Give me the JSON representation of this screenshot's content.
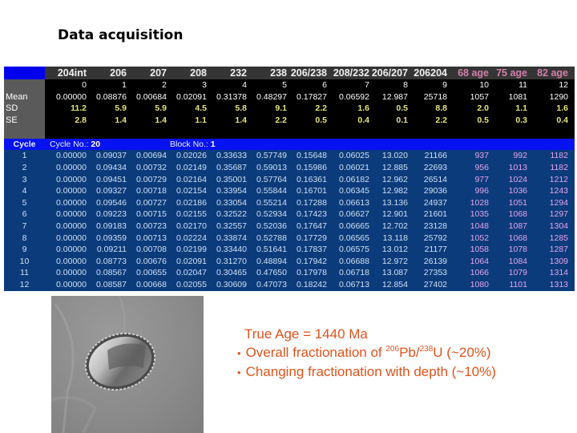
{
  "title": "Data acquisition",
  "table": {
    "headers": [
      "204int",
      "206",
      "207",
      "208",
      "232",
      "238",
      "206/238",
      "208/232",
      "206/207",
      "206204",
      "68 age",
      "75 age",
      "82 age"
    ],
    "index_row": [
      "0",
      "1",
      "2",
      "3",
      "4",
      "5",
      "6",
      "7",
      "8",
      "9",
      "10",
      "11",
      "12"
    ],
    "stats": [
      {
        "label": "Mean",
        "values": [
          "0.00000",
          "0.08876",
          "0.00684",
          "0.02091",
          "0.31378",
          "0.48297",
          "0.17827",
          "0.06592",
          "12.987",
          "25718",
          "1057",
          "1081",
          "1290"
        ]
      },
      {
        "label": "SD",
        "values": [
          "11.2",
          "5.9",
          "5.9",
          "4.5",
          "5.8",
          "9.1",
          "2.2",
          "1.6",
          "0.5",
          "8.8",
          "2.0",
          "1.1",
          "1.6"
        ]
      },
      {
        "label": "SE",
        "values": [
          "2.8",
          "1.4",
          "1.4",
          "1.1",
          "1.4",
          "2.2",
          "0.5",
          "0.4",
          "0.1",
          "2.2",
          "0.5",
          "0.3",
          "0.4"
        ]
      }
    ],
    "cycle_header": {
      "label": "Cycle",
      "cycle_no_label": "Cycle No.:",
      "cycle_no": "20",
      "block_no_label": "Block No.:",
      "block_no": "1"
    },
    "rows": [
      {
        "cycle": "1",
        "values": [
          "0.00000",
          "0.09037",
          "0.00694",
          "0.02026",
          "0.33633",
          "0.57749",
          "0.15648",
          "0.06025",
          "13.020",
          "21166",
          "937",
          "992",
          "1182"
        ]
      },
      {
        "cycle": "2",
        "values": [
          "0.00000",
          "0.09434",
          "0.00732",
          "0.02149",
          "0.35687",
          "0.59013",
          "0.15986",
          "0.06021",
          "12.885",
          "22693",
          "956",
          "1013",
          "1182"
        ]
      },
      {
        "cycle": "3",
        "values": [
          "0.00000",
          "0.09451",
          "0.00729",
          "0.02164",
          "0.35001",
          "0.57764",
          "0.16361",
          "0.06182",
          "12.962",
          "26514",
          "977",
          "1024",
          "1212"
        ]
      },
      {
        "cycle": "4",
        "values": [
          "0.00000",
          "0.09327",
          "0.00718",
          "0.02154",
          "0.33954",
          "0.55844",
          "0.16701",
          "0.06345",
          "12.982",
          "29036",
          "996",
          "1036",
          "1243"
        ]
      },
      {
        "cycle": "5",
        "values": [
          "0.00000",
          "0.09546",
          "0.00727",
          "0.02186",
          "0.33054",
          "0.55214",
          "0.17288",
          "0.06613",
          "13.136",
          "24937",
          "1028",
          "1051",
          "1294"
        ]
      },
      {
        "cycle": "6",
        "values": [
          "0.00000",
          "0.09223",
          "0.00715",
          "0.02155",
          "0.32522",
          "0.52934",
          "0.17423",
          "0.06627",
          "12.901",
          "21601",
          "1035",
          "1068",
          "1297"
        ]
      },
      {
        "cycle": "7",
        "values": [
          "0.00000",
          "0.09183",
          "0.00723",
          "0.02170",
          "0.32557",
          "0.52036",
          "0.17647",
          "0.06665",
          "12.702",
          "23128",
          "1048",
          "1087",
          "1304"
        ]
      },
      {
        "cycle": "8",
        "values": [
          "0.00000",
          "0.09359",
          "0.00713",
          "0.02224",
          "0.33874",
          "0.52788",
          "0.17729",
          "0.06565",
          "13.118",
          "25792",
          "1052",
          "1068",
          "1285"
        ]
      },
      {
        "cycle": "9",
        "values": [
          "0.00000",
          "0.09211",
          "0.00708",
          "0.02199",
          "0.33440",
          "0.51641",
          "0.17837",
          "0.06575",
          "13.012",
          "21177",
          "1058",
          "1078",
          "1287"
        ]
      },
      {
        "cycle": "10",
        "values": [
          "0.00000",
          "0.08773",
          "0.00676",
          "0.02091",
          "0.31270",
          "0.48894",
          "0.17942",
          "0.06688",
          "12.972",
          "26139",
          "1064",
          "1084",
          "1309"
        ]
      },
      {
        "cycle": "11",
        "values": [
          "0.00000",
          "0.08567",
          "0.00655",
          "0.02047",
          "0.30465",
          "0.47650",
          "0.17978",
          "0.06718",
          "13.087",
          "27353",
          "1066",
          "1079",
          "1314"
        ]
      },
      {
        "cycle": "12",
        "values": [
          "0.00000",
          "0.08587",
          "0.00668",
          "0.02055",
          "0.30609",
          "0.47073",
          "0.18242",
          "0.06713",
          "12.854",
          "27402",
          "1080",
          "1101",
          "1313"
        ]
      }
    ]
  },
  "image": {
    "alt": "SEM image of laser ablation pit"
  },
  "notes": {
    "true_age": "True Age = 1440 Ma",
    "line1_pre": "Overall fractionation of ",
    "line1_sup1": "206",
    "line1_mid": "Pb/",
    "line1_sup2": "238",
    "line1_post": "U (~20%)",
    "line2": "Changing fractionation with depth (~10%)"
  },
  "colors": {
    "notes": "#e0531b",
    "age_header": "#d37fa9",
    "stat_values": "#e7e67a",
    "data_bg": "#0b3b7a",
    "cycle_bar": "#0612f0"
  }
}
